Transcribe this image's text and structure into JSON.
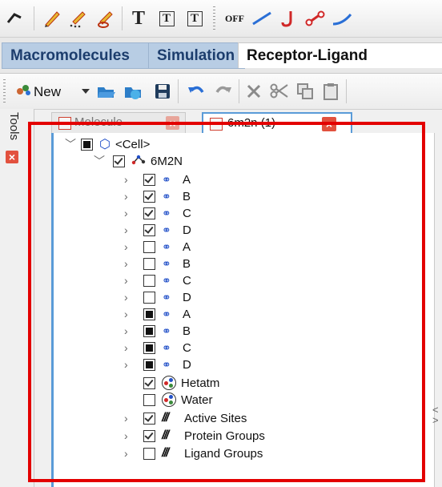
{
  "toolbar_top": {
    "text_tool_label": "T",
    "boxed_text_1": "T",
    "boxed_text_2": "T",
    "off_label": "OFF",
    "icons": [
      "pointer-icon",
      "pencil-icon",
      "pencil-dots-icon",
      "eraser-pencil-icon",
      "text-icon",
      "text-box-icon",
      "text-note-icon",
      "off-toggle-icon",
      "line-icon",
      "hook-icon",
      "link-icon",
      "curve-icon"
    ]
  },
  "main_tabs": [
    {
      "label": "Macromolecules"
    },
    {
      "label": "Simulation"
    },
    {
      "label": "Receptor-Ligand"
    }
  ],
  "toolbar_second": {
    "new_label": "New",
    "icons": [
      "new-icon",
      "dropdown-arrow-icon",
      "open-folder-icon",
      "share-folder-icon",
      "save-icon",
      "undo-icon",
      "redo-icon",
      "delete-icon",
      "cut-icon",
      "copy-icon",
      "paste-icon"
    ]
  },
  "side_panel": {
    "label": "Tools"
  },
  "doc_tabs": [
    {
      "label": "Molecule"
    },
    {
      "label": "6m2n (1)"
    }
  ],
  "tree": {
    "root": "<Cell>",
    "molecule": "6M2N",
    "chains": [
      {
        "label": "A",
        "state": "checked"
      },
      {
        "label": "B",
        "state": "checked"
      },
      {
        "label": "C",
        "state": "checked"
      },
      {
        "label": "D",
        "state": "checked"
      },
      {
        "label": "A",
        "state": "unchecked"
      },
      {
        "label": "B",
        "state": "unchecked"
      },
      {
        "label": "C",
        "state": "unchecked"
      },
      {
        "label": "D",
        "state": "unchecked"
      },
      {
        "label": "A",
        "state": "partial"
      },
      {
        "label": "B",
        "state": "partial"
      },
      {
        "label": "C",
        "state": "partial"
      },
      {
        "label": "D",
        "state": "partial"
      }
    ],
    "extras": [
      {
        "label": "Hetatm",
        "state": "checked"
      },
      {
        "label": "Water",
        "state": "unchecked"
      },
      {
        "label": "Active Sites",
        "state": "checked"
      },
      {
        "label": "Protein Groups",
        "state": "checked"
      },
      {
        "label": "Ligand Groups",
        "state": "unchecked"
      }
    ]
  },
  "colors": {
    "accent_blue": "#5a9bd8",
    "highlight_red": "#e30000",
    "tab_blue": "#b8cde4",
    "chain_icon": "#2250c8"
  }
}
